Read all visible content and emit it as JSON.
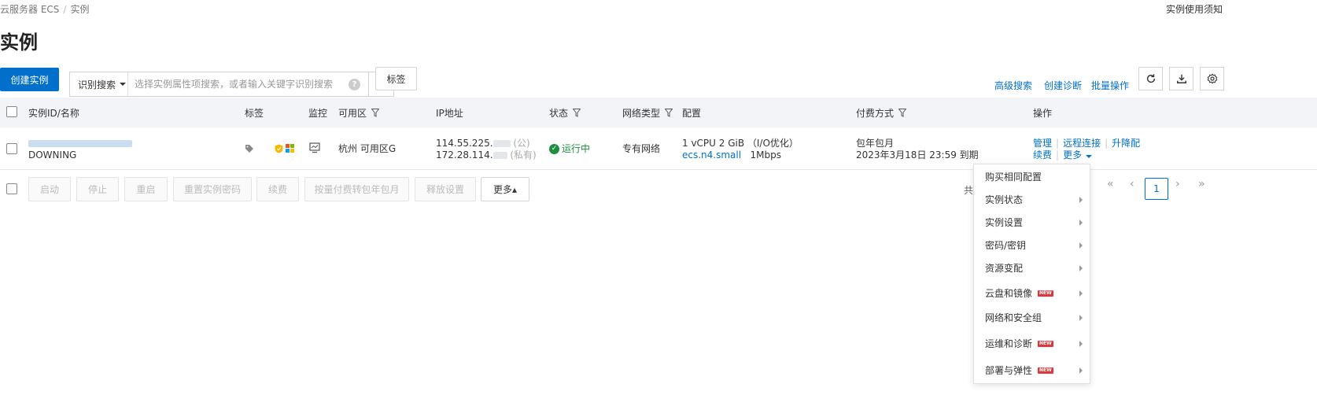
{
  "breadcrumb": {
    "root": "云服务器 ECS",
    "separator": "/",
    "current": "实例"
  },
  "header": {
    "notice_link": "实例使用须知",
    "title": "实例"
  },
  "toolbar": {
    "create_label": "创建实例",
    "search_type": "识别搜索",
    "search_placeholder": "选择实例属性项搜索，或者输入关键字识别搜索",
    "help_icon": "?",
    "tag_button": "标签",
    "advanced_search": "高级搜索",
    "create_diagnosis": "创建诊断",
    "batch_ops": "批量操作"
  },
  "icons": {
    "refresh": "refresh-icon",
    "download": "download-icon",
    "settings": "gear-icon",
    "search": "search-icon"
  },
  "table": {
    "headers": {
      "id_name": "实例ID/名称",
      "tag": "标签",
      "monitor": "监控",
      "zone": "可用区",
      "ip": "IP地址",
      "status": "状态",
      "network": "网络类型",
      "config": "配置",
      "billing": "付费方式",
      "actions": "操作"
    },
    "rows": [
      {
        "name": "DOWNING",
        "zone": "杭州 可用区G",
        "ip_public": "114.55.225.",
        "ip_public_tag": "(公)",
        "ip_private": "172.28.114.",
        "ip_private_tag": "(私有)",
        "status": "运行中",
        "network": "专有网络",
        "config_line1": "1 vCPU 2 GiB （I/O优化）",
        "config_type": "ecs.n4.small",
        "config_bandwidth": "1Mbps",
        "billing_line1": "包年包月",
        "billing_line2": "2023年3月18日 23:59 到期",
        "action_manage": "管理",
        "action_remote": "远程连接",
        "action_upgrade": "升降配",
        "action_renew": "续费",
        "action_more": "更多"
      }
    ]
  },
  "batch_bar": {
    "start": "启动",
    "stop": "停止",
    "restart": "重启",
    "reset_password": "重置实例密码",
    "renew": "续费",
    "convert_billing": "按量付费转包年包月",
    "release": "释放设置",
    "more": "更多▴",
    "total_prefix": "共"
  },
  "pagination": {
    "first": "«",
    "prev": "‹",
    "current": "1",
    "next": "›",
    "last": "»"
  },
  "more_menu": {
    "items": [
      {
        "label": "购买相同配置",
        "submenu": false,
        "new": false
      },
      {
        "label": "实例状态",
        "submenu": true,
        "new": false
      },
      {
        "label": "实例设置",
        "submenu": true,
        "new": false
      },
      {
        "label": "密码/密钥",
        "submenu": true,
        "new": false
      },
      {
        "label": "资源变配",
        "submenu": true,
        "new": false
      },
      {
        "label": "云盘和镜像",
        "submenu": true,
        "new": true
      },
      {
        "label": "网络和安全组",
        "submenu": true,
        "new": false
      },
      {
        "label": "运维和诊断",
        "submenu": true,
        "new": true
      },
      {
        "label": "部署与弹性",
        "submenu": true,
        "new": true
      }
    ],
    "new_badge": "NEW"
  },
  "colors": {
    "primary": "#0070cc",
    "running": "#1e8e3e",
    "new_badge": "#e0373f"
  }
}
